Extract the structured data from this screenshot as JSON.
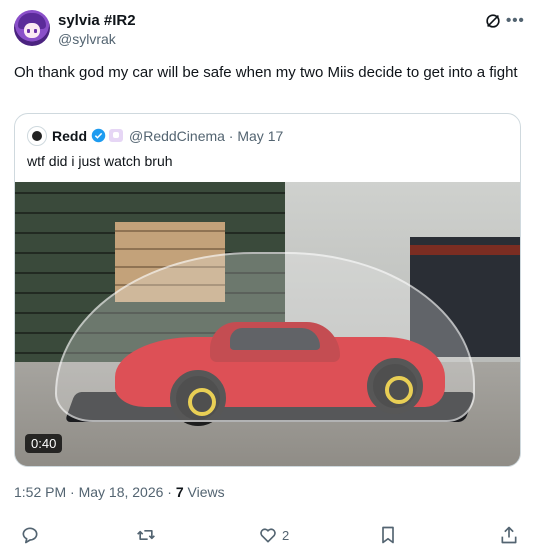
{
  "author": {
    "name": "sylvia #IR2",
    "handle": "@sylvrak"
  },
  "tweet": {
    "text": "Oh thank god my car will be safe when my two Miis decide to get into a fight"
  },
  "quote": {
    "name": "Redd",
    "handle_date": "@ReddCinema · May 17",
    "text": "wtf did i just watch bruh",
    "video_duration": "0:40"
  },
  "meta": {
    "timestamp": "1:52 PM · May 18, 2026 · ",
    "views_count": "7",
    "views_label": " Views"
  },
  "actions": {
    "like_count": "2"
  },
  "icons": {
    "grok": "grok-icon",
    "more": "more-icon",
    "verified": "verified-icon",
    "reply": "reply-icon",
    "repost": "repost-icon",
    "like": "heart-icon",
    "bookmark": "bookmark-icon",
    "share": "share-icon"
  },
  "colors": {
    "verified": "#1d9bf0",
    "secondary_text": "#536471",
    "border": "#cfd9de"
  }
}
